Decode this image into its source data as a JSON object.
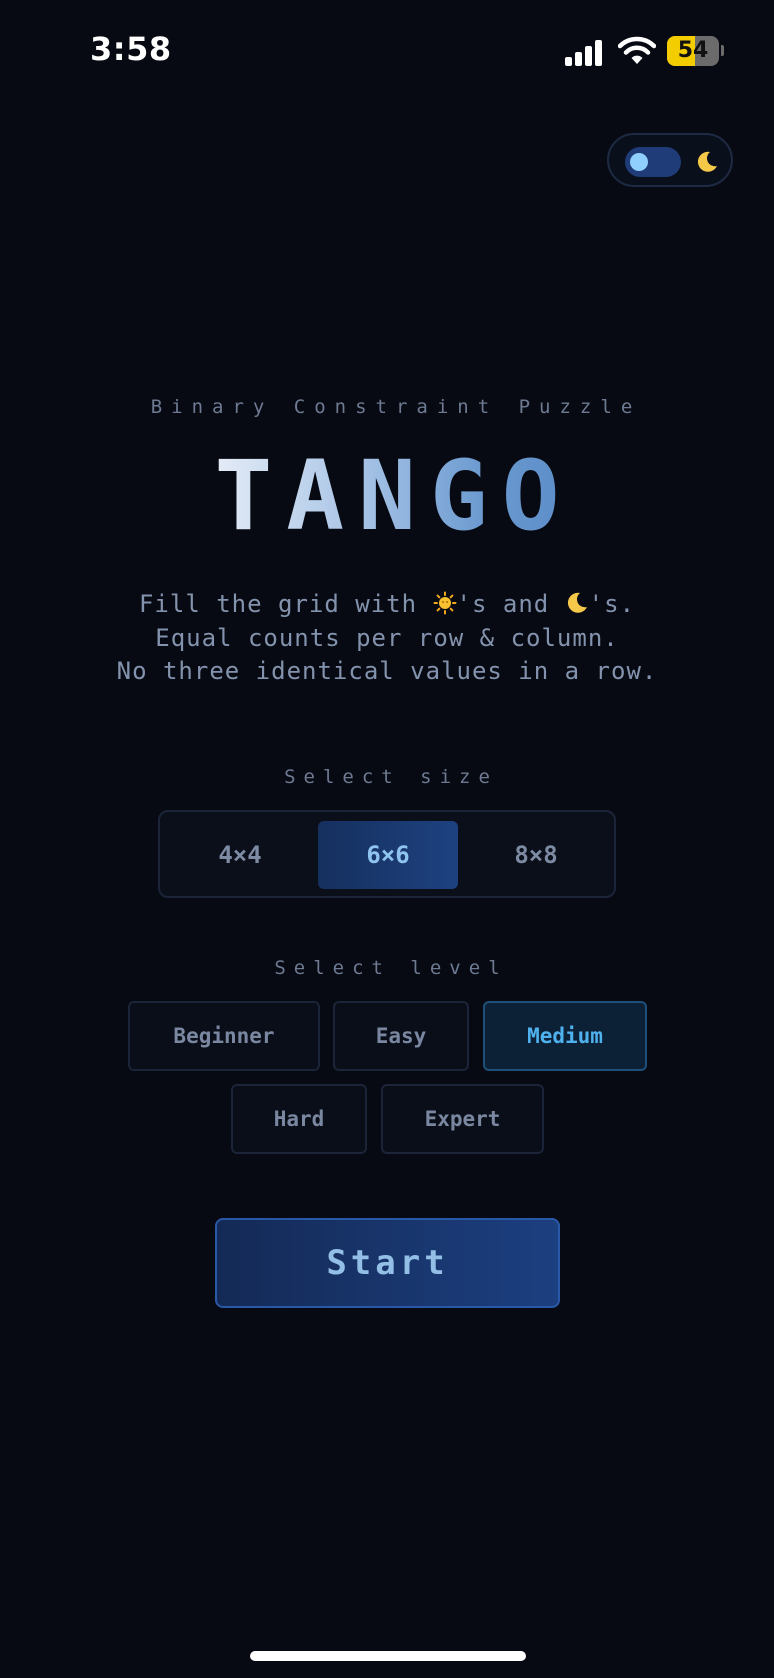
{
  "status_bar": {
    "time": "3:58",
    "battery_level": "54",
    "icons": [
      "signal-icon",
      "wifi-icon",
      "battery-icon"
    ]
  },
  "theme_toggle": {
    "mode": "dark",
    "icon": "moon-icon"
  },
  "hero": {
    "subtitle": "Binary Constraint Puzzle",
    "title": "TANGO",
    "description": {
      "line1_prefix": "Fill the grid with ",
      "line1_mid": "'s and ",
      "line1_suffix": "'s.",
      "line2": "Equal counts per row & column.",
      "line3": "No three identical values in a row.",
      "icons": [
        "sun-icon",
        "moon-icon"
      ]
    }
  },
  "size_selector": {
    "label": "Select size",
    "options": [
      "4×4",
      "6×6",
      "8×8"
    ],
    "selected": "6×6"
  },
  "level_selector": {
    "label": "Select level",
    "options": [
      "Beginner",
      "Easy",
      "Medium",
      "Hard",
      "Expert"
    ],
    "selected": "Medium"
  },
  "start_button": {
    "label": "Start"
  },
  "colors": {
    "background": "#070a12",
    "accent": "#1d4180",
    "active_level_text": "#4fb2ef",
    "title_gradient_start": "#e4ecf6",
    "title_gradient_end": "#5c8cc8"
  }
}
